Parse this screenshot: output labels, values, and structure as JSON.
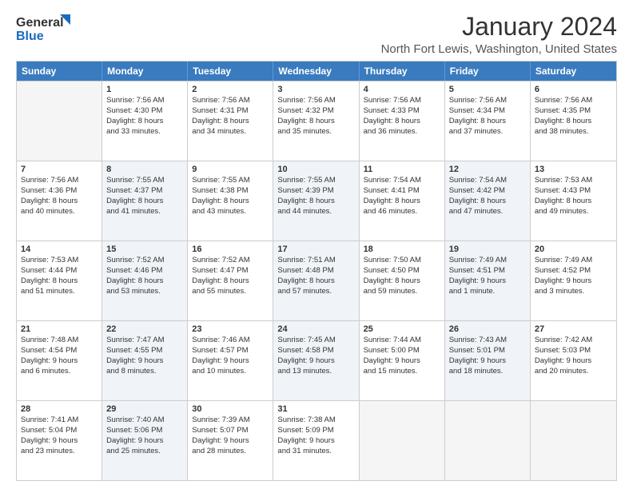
{
  "header": {
    "logo_general": "General",
    "logo_blue": "Blue",
    "month": "January 2024",
    "location": "North Fort Lewis, Washington, United States"
  },
  "days_of_week": [
    "Sunday",
    "Monday",
    "Tuesday",
    "Wednesday",
    "Thursday",
    "Friday",
    "Saturday"
  ],
  "weeks": [
    [
      {
        "day": "",
        "info": "",
        "shade": true
      },
      {
        "day": "1",
        "info": "Sunrise: 7:56 AM\nSunset: 4:30 PM\nDaylight: 8 hours\nand 33 minutes."
      },
      {
        "day": "2",
        "info": "Sunrise: 7:56 AM\nSunset: 4:31 PM\nDaylight: 8 hours\nand 34 minutes."
      },
      {
        "day": "3",
        "info": "Sunrise: 7:56 AM\nSunset: 4:32 PM\nDaylight: 8 hours\nand 35 minutes."
      },
      {
        "day": "4",
        "info": "Sunrise: 7:56 AM\nSunset: 4:33 PM\nDaylight: 8 hours\nand 36 minutes."
      },
      {
        "day": "5",
        "info": "Sunrise: 7:56 AM\nSunset: 4:34 PM\nDaylight: 8 hours\nand 37 minutes."
      },
      {
        "day": "6",
        "info": "Sunrise: 7:56 AM\nSunset: 4:35 PM\nDaylight: 8 hours\nand 38 minutes."
      }
    ],
    [
      {
        "day": "7",
        "info": "Sunrise: 7:56 AM\nSunset: 4:36 PM\nDaylight: 8 hours\nand 40 minutes."
      },
      {
        "day": "8",
        "info": "Sunrise: 7:55 AM\nSunset: 4:37 PM\nDaylight: 8 hours\nand 41 minutes.",
        "shade": true
      },
      {
        "day": "9",
        "info": "Sunrise: 7:55 AM\nSunset: 4:38 PM\nDaylight: 8 hours\nand 43 minutes."
      },
      {
        "day": "10",
        "info": "Sunrise: 7:55 AM\nSunset: 4:39 PM\nDaylight: 8 hours\nand 44 minutes.",
        "shade": true
      },
      {
        "day": "11",
        "info": "Sunrise: 7:54 AM\nSunset: 4:41 PM\nDaylight: 8 hours\nand 46 minutes."
      },
      {
        "day": "12",
        "info": "Sunrise: 7:54 AM\nSunset: 4:42 PM\nDaylight: 8 hours\nand 47 minutes.",
        "shade": true
      },
      {
        "day": "13",
        "info": "Sunrise: 7:53 AM\nSunset: 4:43 PM\nDaylight: 8 hours\nand 49 minutes."
      }
    ],
    [
      {
        "day": "14",
        "info": "Sunrise: 7:53 AM\nSunset: 4:44 PM\nDaylight: 8 hours\nand 51 minutes."
      },
      {
        "day": "15",
        "info": "Sunrise: 7:52 AM\nSunset: 4:46 PM\nDaylight: 8 hours\nand 53 minutes.",
        "shade": true
      },
      {
        "day": "16",
        "info": "Sunrise: 7:52 AM\nSunset: 4:47 PM\nDaylight: 8 hours\nand 55 minutes."
      },
      {
        "day": "17",
        "info": "Sunrise: 7:51 AM\nSunset: 4:48 PM\nDaylight: 8 hours\nand 57 minutes.",
        "shade": true
      },
      {
        "day": "18",
        "info": "Sunrise: 7:50 AM\nSunset: 4:50 PM\nDaylight: 8 hours\nand 59 minutes."
      },
      {
        "day": "19",
        "info": "Sunrise: 7:49 AM\nSunset: 4:51 PM\nDaylight: 9 hours\nand 1 minute.",
        "shade": true
      },
      {
        "day": "20",
        "info": "Sunrise: 7:49 AM\nSunset: 4:52 PM\nDaylight: 9 hours\nand 3 minutes."
      }
    ],
    [
      {
        "day": "21",
        "info": "Sunrise: 7:48 AM\nSunset: 4:54 PM\nDaylight: 9 hours\nand 6 minutes."
      },
      {
        "day": "22",
        "info": "Sunrise: 7:47 AM\nSunset: 4:55 PM\nDaylight: 9 hours\nand 8 minutes.",
        "shade": true
      },
      {
        "day": "23",
        "info": "Sunrise: 7:46 AM\nSunset: 4:57 PM\nDaylight: 9 hours\nand 10 minutes."
      },
      {
        "day": "24",
        "info": "Sunrise: 7:45 AM\nSunset: 4:58 PM\nDaylight: 9 hours\nand 13 minutes.",
        "shade": true
      },
      {
        "day": "25",
        "info": "Sunrise: 7:44 AM\nSunset: 5:00 PM\nDaylight: 9 hours\nand 15 minutes."
      },
      {
        "day": "26",
        "info": "Sunrise: 7:43 AM\nSunset: 5:01 PM\nDaylight: 9 hours\nand 18 minutes.",
        "shade": true
      },
      {
        "day": "27",
        "info": "Sunrise: 7:42 AM\nSunset: 5:03 PM\nDaylight: 9 hours\nand 20 minutes."
      }
    ],
    [
      {
        "day": "28",
        "info": "Sunrise: 7:41 AM\nSunset: 5:04 PM\nDaylight: 9 hours\nand 23 minutes."
      },
      {
        "day": "29",
        "info": "Sunrise: 7:40 AM\nSunset: 5:06 PM\nDaylight: 9 hours\nand 25 minutes.",
        "shade": true
      },
      {
        "day": "30",
        "info": "Sunrise: 7:39 AM\nSunset: 5:07 PM\nDaylight: 9 hours\nand 28 minutes."
      },
      {
        "day": "31",
        "info": "Sunrise: 7:38 AM\nSunset: 5:09 PM\nDaylight: 9 hours\nand 31 minutes."
      },
      {
        "day": "",
        "info": "",
        "shade": true
      },
      {
        "day": "",
        "info": "",
        "shade": true
      },
      {
        "day": "",
        "info": "",
        "shade": true
      }
    ]
  ]
}
